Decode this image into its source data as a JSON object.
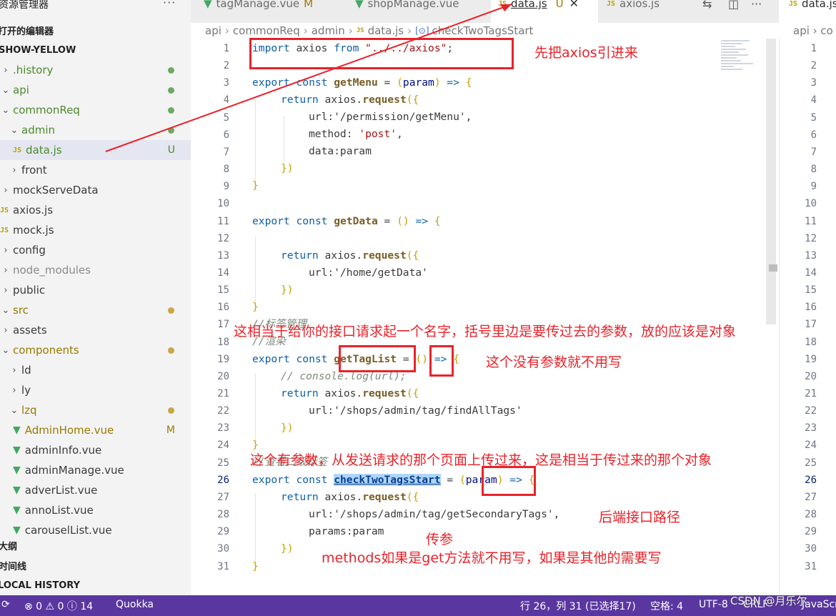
{
  "sidebar": {
    "title": "资源管理器",
    "ellipsis": "···",
    "open_editors": "打开的编辑器",
    "project": "SHOW-YELLOW",
    "items": [
      {
        "label": ".history",
        "chev": "›",
        "kind": "folder",
        "color": "green",
        "mark": "dot"
      },
      {
        "label": "api",
        "chev": "⌄",
        "kind": "folder",
        "color": "green",
        "mark": "dot"
      },
      {
        "label": "commonReq",
        "chev": "⌄",
        "kind": "folder",
        "color": "green",
        "mark": "dot"
      },
      {
        "label": "admin",
        "chev": "⌄",
        "kind": "folder",
        "color": "green",
        "mark": "dot"
      },
      {
        "label": "data.js",
        "kind": "js",
        "color": "green",
        "badge": "U",
        "selected": true
      },
      {
        "label": "front",
        "chev": "›",
        "kind": "folder"
      },
      {
        "label": "mockServeData",
        "chev": "›",
        "kind": "folder"
      },
      {
        "label": "axios.js",
        "kind": "js"
      },
      {
        "label": "mock.js",
        "kind": "js"
      },
      {
        "label": "config",
        "chev": "›",
        "kind": "folder"
      },
      {
        "label": "node_modules",
        "chev": "›",
        "kind": "folder",
        "color": "dim"
      },
      {
        "label": "public",
        "chev": "›",
        "kind": "folder"
      },
      {
        "label": "src",
        "chev": "⌄",
        "kind": "folder",
        "color": "yellow",
        "mark": "dot"
      },
      {
        "label": "assets",
        "chev": "›",
        "kind": "folder"
      },
      {
        "label": "components",
        "chev": "⌄",
        "kind": "folder",
        "color": "yellow",
        "mark": "dot"
      },
      {
        "label": "ld",
        "chev": "›",
        "kind": "folder"
      },
      {
        "label": "ly",
        "chev": "›",
        "kind": "folder"
      },
      {
        "label": "lzq",
        "chev": "⌄",
        "kind": "folder",
        "color": "yellow",
        "mark": "dot"
      },
      {
        "label": "AdminHome.vue",
        "kind": "vue",
        "color": "yellow",
        "badge": "M"
      },
      {
        "label": "adminInfo.vue",
        "kind": "vue"
      },
      {
        "label": "adminManage.vue",
        "kind": "vue"
      },
      {
        "label": "adverList.vue",
        "kind": "vue"
      },
      {
        "label": "annoList.vue",
        "kind": "vue"
      },
      {
        "label": "carouselList.vue",
        "kind": "vue"
      }
    ],
    "outline": "大纲",
    "timeline": "时间线",
    "local_history": "LOCAL HISTORY"
  },
  "tabs": {
    "tab1": {
      "label": "tagManage.vue",
      "mod": "M"
    },
    "tab2": {
      "label": "shopManage.vue"
    },
    "tab3": {
      "label": "data.js",
      "mod": "U",
      "close": "✕"
    },
    "tab4": {
      "label": "axios.js"
    },
    "right_tab": {
      "label": "data.js"
    },
    "icon_compare": "⇆",
    "icon_split": "◫",
    "icon_more": "···"
  },
  "breadcrumb": {
    "items": [
      "api",
      "commonReq",
      "admin",
      "data.js",
      "checkTwoTagsStart"
    ],
    "right": "api › co"
  },
  "editor": {
    "line_numbers": [
      "1",
      "2",
      "3",
      "4",
      "5",
      "6",
      "7",
      "8",
      "9",
      "10",
      "11",
      "12",
      "13",
      "14",
      "15",
      "16",
      "17",
      "18",
      "19",
      "20",
      "21",
      "22",
      "23",
      "24",
      "25",
      "26",
      "27",
      "28",
      "29",
      "30",
      "31"
    ],
    "current_line": "26",
    "code": {
      "l1_import": "import",
      "l1_axios": " axios ",
      "l1_from": "from",
      "l1_path": " \"../../axios\"",
      "l1_semi": ";",
      "l3_export": "export",
      "l3_const": " const ",
      "l3_name": "getMenu",
      "l3_eq": " = ",
      "l3_p1": "(",
      "l3_param": "param",
      "l3_p2": ")",
      "l3_arrow": " => ",
      "l3_brace": "{",
      "l4_return": "return",
      "l4_axios": " axios.",
      "l4_request": "request",
      "l4_open": "({",
      "l5": "url:'/permission/getMenu',",
      "l6_key": "method: ",
      "l6_val": "'post'",
      "l6_comma": ",",
      "l7": "data:param",
      "l8": "})",
      "l9": "}",
      "l11_export": "export",
      "l11_const": " const ",
      "l11_name": "getData",
      "l11_eq": " = ",
      "l11_paren": "()",
      "l11_arrow": " => ",
      "l11_brace": "{",
      "l13_return": "return",
      "l13_axios": " axios.",
      "l13_request": "request",
      "l13_open": "({",
      "l14": "url:'/home/getData'",
      "l15": "})",
      "l16": "}",
      "l17": "//标签管理",
      "l18": "//渲染",
      "l19_export": "export",
      "l19_const": " const ",
      "l19_name": "getTagList",
      "l19_eq": " = ",
      "l19_paren": "()",
      "l19_arrow": " => ",
      "l19_brace": "{",
      "l20": "// console.log(url);",
      "l21_return": "return",
      "l21_axios": " axios.",
      "l21_request": "request",
      "l21_open": "({",
      "l22": "url:'/shops/admin/tag/findAllTags'",
      "l23": "})",
      "l24": "}",
      "l25": "//查看二级标签",
      "l26_export": "export",
      "l26_const": " const ",
      "l26_name": "checkTwoTagsStart",
      "l26_eq": " = ",
      "l26_p1": "(",
      "l26_param": "param",
      "l26_p2": ")",
      "l26_arrow": " => ",
      "l26_brace": "{",
      "l27_return": "return",
      "l27_axios": " axios.",
      "l27_request": "request",
      "l27_open": "({",
      "l28": "url:'/shops/admin/tag/getSecondaryTags',",
      "l29": "params:param",
      "l30": "})",
      "l31": "}"
    }
  },
  "annotations": {
    "a1": "先把axios引进来",
    "a2": "这相当于给你的接口请求起一个名字，括号里边是要传过去的参数，放的应该是对象",
    "a3": "这个没有参数就不用写",
    "a4": "这个有参数，从发送请求的那个页面上传过来，这是相当于传过来的那个对象",
    "a5": "后端接口路径",
    "a6": "传参",
    "a7": "methods如果是get方法就不用写，如果是其他的需要写"
  },
  "statusbar": {
    "sync": "⟳",
    "problems": "⊗ 0 ⚠ 0 ⓘ 14",
    "quokka": "Quokka",
    "position": "行 26，列 31 (已选择17)",
    "spaces": "空格: 4",
    "encoding": "UTF-8",
    "eol": "CRLF",
    "language": "JavaScript",
    "watermark": "CSDN @月乐尔"
  },
  "colors": {
    "accent_red": "#e8232a",
    "statusbar_bg": "#5a37a0",
    "selection": "#add6ff"
  }
}
